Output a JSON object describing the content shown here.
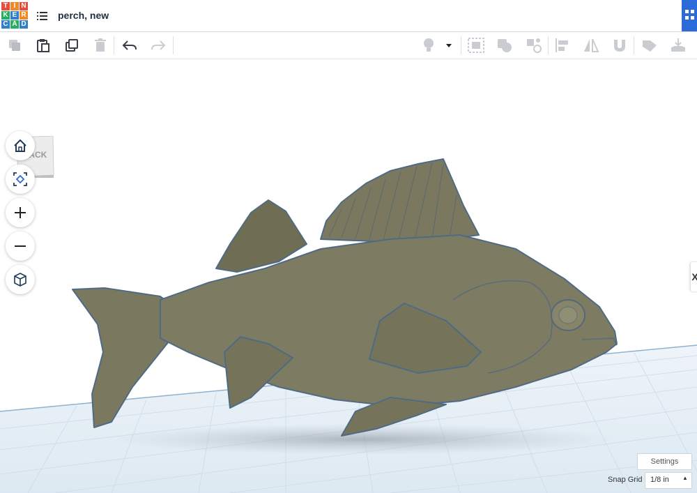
{
  "app": {
    "logo_letters": [
      "T",
      "I",
      "N",
      "K",
      "E",
      "R",
      "C",
      "A",
      "D"
    ],
    "logo_colors": [
      "#e74c3c",
      "#e74c3c",
      "#e74c3c",
      "#27ae60",
      "#27ae60",
      "#27ae60",
      "#2f80c6",
      "#2f80c6",
      "#2f80c6"
    ],
    "design_title": "perch, new"
  },
  "toolbar": {
    "buttons": [
      "copy",
      "paste",
      "duplicate",
      "delete",
      "undo",
      "redo"
    ],
    "right_buttons": [
      "show-all",
      "notes",
      "group",
      "ungroup",
      "align",
      "mirror",
      "workplane",
      "ruler",
      "import-export"
    ]
  },
  "viewcube": {
    "face_label": "BACK"
  },
  "nav": {
    "buttons": [
      "home-view",
      "fit-all",
      "zoom-in",
      "zoom-out",
      "perspective-toggle"
    ]
  },
  "right_panel_tab": "X",
  "footer": {
    "settings_label": "Settings",
    "snap_grid_label": "Snap Grid",
    "snap_grid_value": "1/8 in"
  },
  "colors": {
    "accent": "#2b6ad8",
    "model": "#7d7c62",
    "grid_line": "#cfdde9"
  }
}
